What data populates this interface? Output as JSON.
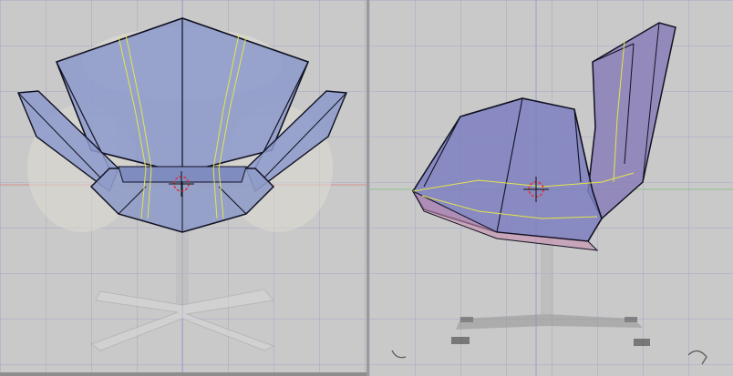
{
  "viewports": [
    {
      "name": "front",
      "label": ""
    },
    {
      "name": "side",
      "label": ""
    }
  ],
  "colors": {
    "viewport_bg": "#c9c9c9",
    "grid": "#9696c8",
    "mesh_fill": "#8a96c8",
    "mesh_edge": "#111122",
    "seam": "#e6e64a",
    "axis_x": "#d07070",
    "axis_y": "#70b070",
    "cursor_red": "#e03030"
  },
  "icons": [
    "3d-cursor-icon",
    "3d-cursor-icon",
    "view-axis-icon"
  ]
}
